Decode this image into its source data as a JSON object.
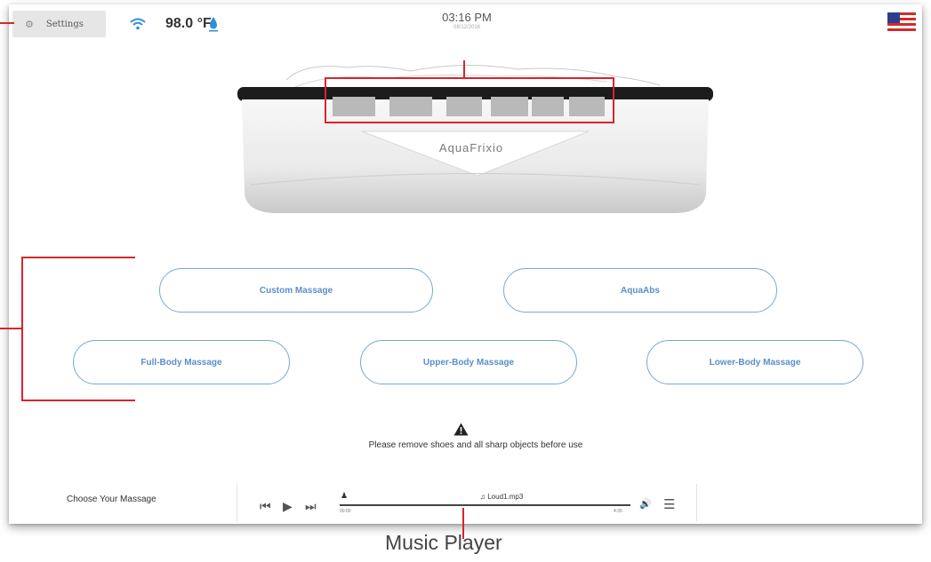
{
  "top_bar": {
    "settings_label": "Settings",
    "temperature": "98.0 °F",
    "time": "03:16 PM",
    "date": "08/12/2016"
  },
  "device": {
    "brand": "AquaFrixio"
  },
  "massage_options": {
    "custom": "Custom Massage",
    "aquaabs": "AquaAbs",
    "full_body": "Full-Body Massage",
    "upper_body": "Upper-Body Massage",
    "lower_body": "Lower-Body Massage"
  },
  "warning_text": "Please remove shoes and all sharp objects before use",
  "bottom_bar": {
    "choose_label": "Choose Your Massage"
  },
  "music_player": {
    "track": "Loud1.mp3",
    "time_elapsed": "00:00",
    "time_total": "4:35"
  },
  "annotations": {
    "music_player_label": "Music Player"
  },
  "colors": {
    "accent_blue": "#5b8fc7",
    "button_border": "#7aa7d6",
    "annotation_red": "#d6262d"
  }
}
